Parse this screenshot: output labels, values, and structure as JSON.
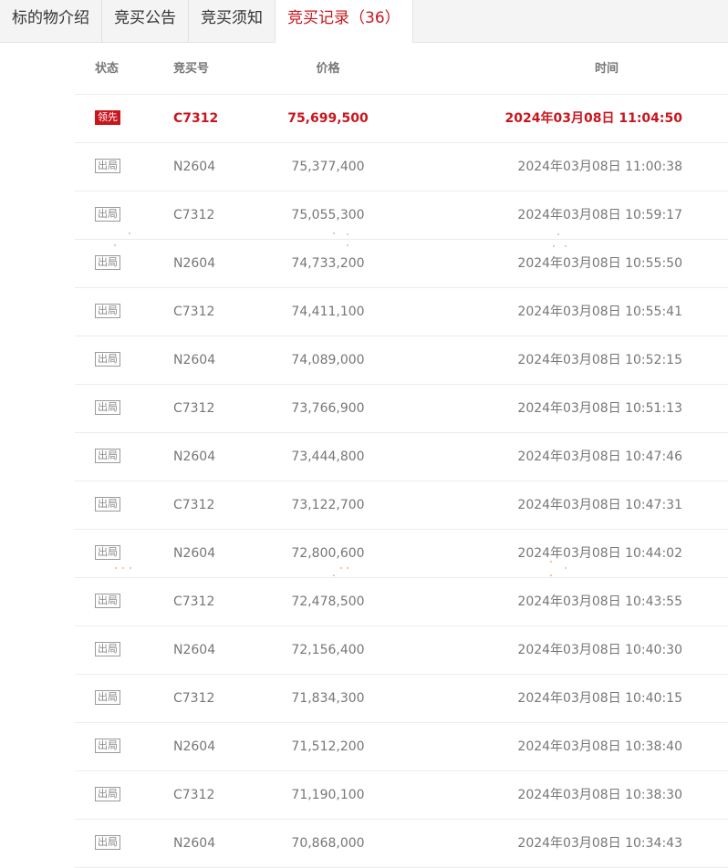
{
  "tabs": [
    {
      "label": "标的物介绍"
    },
    {
      "label": "竞买公告"
    },
    {
      "label": "竞买须知"
    },
    {
      "label": "竞买记录（36）"
    }
  ],
  "table": {
    "headers": {
      "status": "状态",
      "code": "竞买号",
      "price": "价格",
      "time": "时间"
    },
    "rows": [
      {
        "status": "领先",
        "code": "C7312",
        "price": "75,699,500",
        "time": "2024年03月08日 11:04:50"
      },
      {
        "status": "出局",
        "code": "N2604",
        "price": "75,377,400",
        "time": "2024年03月08日 11:00:38"
      },
      {
        "status": "出局",
        "code": "C7312",
        "price": "75,055,300",
        "time": "2024年03月08日 10:59:17"
      },
      {
        "status": "出局",
        "code": "N2604",
        "price": "74,733,200",
        "time": "2024年03月08日 10:55:50"
      },
      {
        "status": "出局",
        "code": "C7312",
        "price": "74,411,100",
        "time": "2024年03月08日 10:55:41"
      },
      {
        "status": "出局",
        "code": "N2604",
        "price": "74,089,000",
        "time": "2024年03月08日 10:52:15"
      },
      {
        "status": "出局",
        "code": "C7312",
        "price": "73,766,900",
        "time": "2024年03月08日 10:51:13"
      },
      {
        "status": "出局",
        "code": "N2604",
        "price": "73,444,800",
        "time": "2024年03月08日 10:47:46"
      },
      {
        "status": "出局",
        "code": "C7312",
        "price": "73,122,700",
        "time": "2024年03月08日 10:47:31"
      },
      {
        "status": "出局",
        "code": "N2604",
        "price": "72,800,600",
        "time": "2024年03月08日 10:44:02"
      },
      {
        "status": "出局",
        "code": "C7312",
        "price": "72,478,500",
        "time": "2024年03月08日 10:43:55"
      },
      {
        "status": "出局",
        "code": "N2604",
        "price": "72,156,400",
        "time": "2024年03月08日 10:40:30"
      },
      {
        "status": "出局",
        "code": "C7312",
        "price": "71,834,300",
        "time": "2024年03月08日 10:40:15"
      },
      {
        "status": "出局",
        "code": "N2604",
        "price": "71,512,200",
        "time": "2024年03月08日 10:38:40"
      },
      {
        "status": "出局",
        "code": "C7312",
        "price": "71,190,100",
        "time": "2024年03月08日 10:38:30"
      },
      {
        "status": "出局",
        "code": "N2604",
        "price": "70,868,000",
        "time": "2024年03月08日 10:34:43"
      }
    ]
  },
  "colors": {
    "accent": "#c8161d",
    "text": "#777777",
    "border": "#ececec"
  }
}
